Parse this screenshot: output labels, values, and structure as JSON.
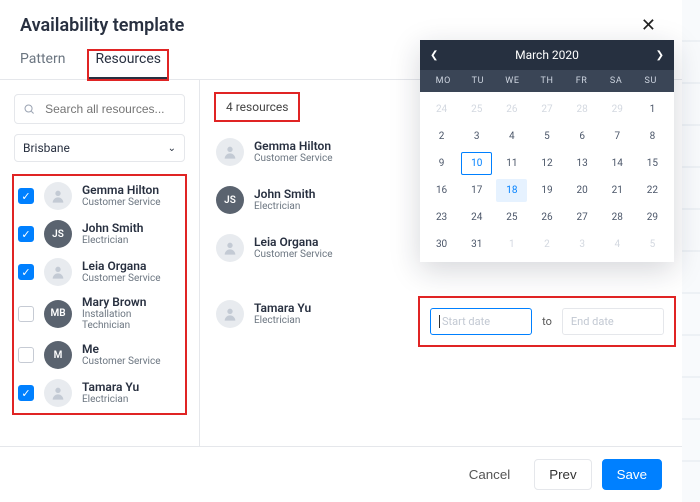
{
  "modal": {
    "title": "Availability template",
    "tabs": {
      "pattern": "Pattern",
      "resources": "Resources",
      "active": "resources"
    },
    "search": {
      "placeholder": "Search all resources..."
    },
    "location": {
      "selected": "Brisbane"
    },
    "resources": [
      {
        "name": "Gemma Hilton",
        "role": "Customer Service",
        "initials": "",
        "checked": true,
        "ghost": true
      },
      {
        "name": "John Smith",
        "role": "Electrician",
        "initials": "JS",
        "checked": true,
        "ghost": false
      },
      {
        "name": "Leia Organa",
        "role": "Customer Service",
        "initials": "",
        "checked": true,
        "ghost": true
      },
      {
        "name": "Mary Brown",
        "role": "Installation Technician",
        "initials": "MB",
        "checked": false,
        "ghost": false
      },
      {
        "name": "Me",
        "role": "Customer Service",
        "initials": "M",
        "checked": false,
        "ghost": false
      },
      {
        "name": "Tamara Yu",
        "role": "Electrician",
        "initials": "",
        "checked": true,
        "ghost": true
      }
    ],
    "selected_count_label": "4 resources",
    "selected": [
      {
        "name": "Gemma Hilton",
        "role": "Customer Service",
        "initials": "",
        "ghost": true
      },
      {
        "name": "John Smith",
        "role": "Electrician",
        "initials": "JS",
        "ghost": false
      },
      {
        "name": "Leia Organa",
        "role": "Customer Service",
        "initials": "",
        "ghost": true
      },
      {
        "name": "Tamara Yu",
        "role": "Electrician",
        "initials": "",
        "ghost": true
      }
    ]
  },
  "calendar": {
    "title": "March 2020",
    "dow": [
      "MO",
      "TU",
      "WE",
      "TH",
      "FR",
      "SA",
      "SU"
    ],
    "grid": [
      {
        "n": 24,
        "out": true
      },
      {
        "n": 25,
        "out": true
      },
      {
        "n": 26,
        "out": true
      },
      {
        "n": 27,
        "out": true
      },
      {
        "n": 28,
        "out": true
      },
      {
        "n": 29,
        "out": true
      },
      {
        "n": 1
      },
      {
        "n": 2
      },
      {
        "n": 3
      },
      {
        "n": 4
      },
      {
        "n": 5
      },
      {
        "n": 6
      },
      {
        "n": 7
      },
      {
        "n": 8
      },
      {
        "n": 9
      },
      {
        "n": 10,
        "ring": true
      },
      {
        "n": 11
      },
      {
        "n": 12
      },
      {
        "n": 13
      },
      {
        "n": 14
      },
      {
        "n": 15
      },
      {
        "n": 16
      },
      {
        "n": 17
      },
      {
        "n": 18,
        "sel": true
      },
      {
        "n": 19
      },
      {
        "n": 20
      },
      {
        "n": 21
      },
      {
        "n": 22
      },
      {
        "n": 23
      },
      {
        "n": 24
      },
      {
        "n": 25
      },
      {
        "n": 26
      },
      {
        "n": 27
      },
      {
        "n": 28
      },
      {
        "n": 29
      },
      {
        "n": 30
      },
      {
        "n": 31
      },
      {
        "n": 1,
        "out": true
      },
      {
        "n": 2,
        "out": true
      },
      {
        "n": 3,
        "out": true
      },
      {
        "n": 4,
        "out": true
      },
      {
        "n": 5,
        "out": true
      }
    ]
  },
  "date_range": {
    "start_placeholder": "Start date",
    "end_placeholder": "End date",
    "between_label": "to"
  },
  "footer": {
    "cancel": "Cancel",
    "prev": "Prev",
    "save": "Save"
  }
}
